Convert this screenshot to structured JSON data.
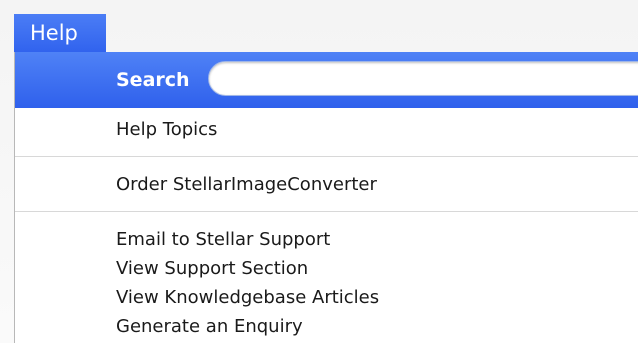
{
  "menubar": {
    "help_label": "Help"
  },
  "menu": {
    "search_label": "Search",
    "search_value": "",
    "items": [
      {
        "label": "Help Topics"
      },
      {
        "label": "Order StellarImageConverter"
      },
      {
        "label": "Email to Stellar Support"
      },
      {
        "label": "View Support Section"
      },
      {
        "label": "View Knowledgebase Articles"
      },
      {
        "label": "Generate an Enquiry"
      }
    ]
  },
  "colors": {
    "highlight": "#3468ef",
    "highlight_text": "#ffffff",
    "text": "#1a1a1a",
    "separator": "#d8d8d8"
  }
}
